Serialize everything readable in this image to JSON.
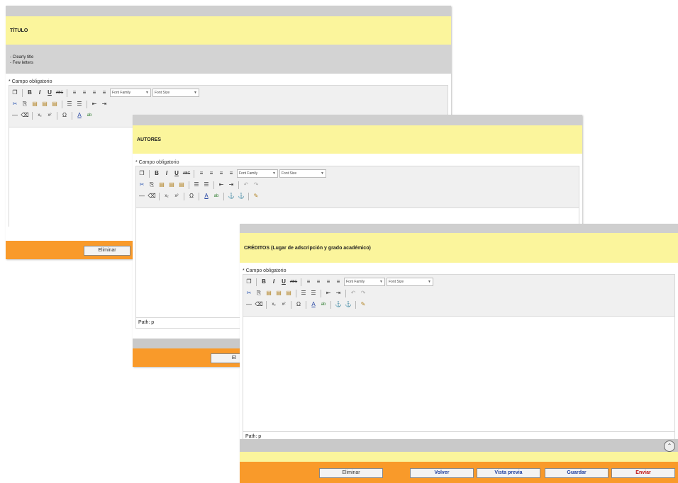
{
  "windows": {
    "titulo": {
      "title": "TÍTULO",
      "desc_lines": [
        "- Clearly title",
        "- Few letters"
      ],
      "required": "* Campo obligatorio",
      "font_family": "Font Family",
      "font_size": "Font Size",
      "delete_label": "Eliminar"
    },
    "autores": {
      "title": "AUTORES",
      "required": "* Campo obligatorio",
      "font_family": "Font Family",
      "font_size": "Font Size",
      "path": "Path: p",
      "delete_label": "El"
    },
    "creditos": {
      "title": "CRÉDITOS (Lugar de adscripción y grado académico)",
      "required": "* Campo obligatorio",
      "font_family": "Font Family",
      "font_size": "Font Size",
      "path": "Path: p",
      "buttons": {
        "delete": "Eliminar",
        "back": "Volver",
        "preview": "Vista previa",
        "save": "Guardar",
        "send": "Enviar"
      }
    }
  },
  "toolbar_glyphs": {
    "row1": [
      "❐",
      "B",
      "I",
      "U",
      "ABC",
      "≡",
      "≡",
      "≡",
      "≡"
    ],
    "row2": [
      "✂",
      "⎘",
      "📋",
      "📋",
      "📋",
      "☰",
      "☰",
      "⇤",
      "⇥",
      "↶",
      "↷"
    ],
    "row3": [
      "—",
      "⌫",
      "x₂",
      "x²",
      "Ω",
      "A",
      "ab",
      "⚓",
      "⚓",
      "✎"
    ]
  },
  "colors": {
    "title_bg": "#fbf59c",
    "orange": "#f99a2a",
    "grey": "#cfcfcf"
  }
}
